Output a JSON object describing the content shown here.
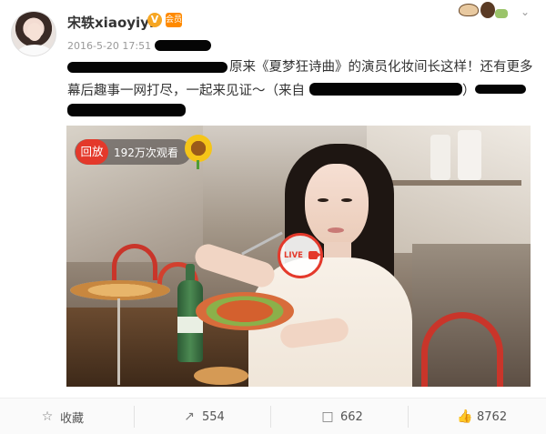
{
  "post": {
    "username": "宋轶xiaoyiyi",
    "verified_badge": "V",
    "member_badge": "会员",
    "timestamp": "2016-5-20 17:51",
    "text_line1": "原来《夏梦狂诗曲》的演员化妆间长这样！还有更多",
    "text_line2": "幕后趣事一网打尽，一起来见证～（来自",
    "text_line2_close": "）"
  },
  "video": {
    "replay_label": "回放",
    "view_count": "192万次观看",
    "live_label": "LIVE"
  },
  "actions": {
    "favorite_label": "收藏",
    "repost_count": "554",
    "comment_count": "662",
    "like_count": "8762"
  },
  "icons": {
    "favorite": "star-outline-icon",
    "repost": "share-arrow-icon",
    "comment": "comment-bubble-icon",
    "like": "thumbs-up-icon",
    "menu": "chevron-down-icon"
  },
  "colors": {
    "live_red": "#e4392b",
    "verified_orange": "#f6a623",
    "text": "#333333",
    "muted": "#999999"
  }
}
